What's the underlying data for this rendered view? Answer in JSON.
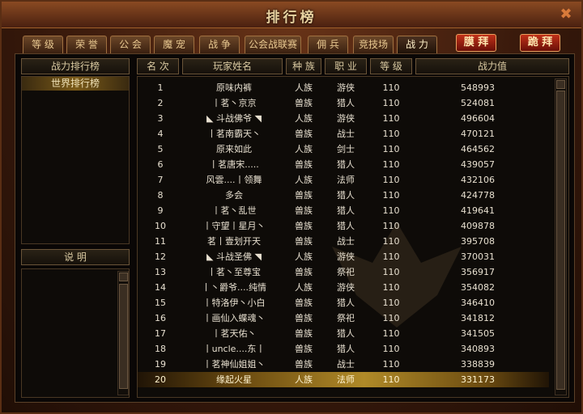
{
  "window": {
    "title": "排行榜",
    "close_icon": "✖"
  },
  "tabs": [
    {
      "label": "等 级",
      "active": false
    },
    {
      "label": "荣 誉",
      "active": false
    },
    {
      "label": "公 会",
      "active": false
    },
    {
      "label": "魔 宠",
      "active": false
    },
    {
      "label": "战 争",
      "active": false
    },
    {
      "label": "公会战联赛",
      "active": false
    },
    {
      "label": "佣 兵",
      "active": false
    },
    {
      "label": "竞技场",
      "active": false
    },
    {
      "label": "战 力",
      "active": true
    }
  ],
  "buttons": {
    "worship": "膜 拜",
    "kneel": "跪 拜"
  },
  "left_panel": {
    "header": "战力排行榜",
    "items": [
      {
        "label": "世界排行榜",
        "selected": true
      }
    ],
    "info_header": "说  明"
  },
  "table": {
    "columns": [
      "名 次",
      "玩家姓名",
      "种 族",
      "职 业",
      "等 级",
      "战力值"
    ],
    "rows": [
      {
        "rank": "1",
        "name": "原味内裤",
        "race": "人族",
        "class": "游侠",
        "level": "110",
        "power": "548993"
      },
      {
        "rank": "2",
        "name": "丨茗丶京京",
        "race": "兽族",
        "class": "猎人",
        "level": "110",
        "power": "524081"
      },
      {
        "rank": "3",
        "name": "◣ 斗战佛爷 ◥",
        "race": "人族",
        "class": "游侠",
        "level": "110",
        "power": "496604"
      },
      {
        "rank": "4",
        "name": "丨茗南霸天丶",
        "race": "兽族",
        "class": "战士",
        "level": "110",
        "power": "470121"
      },
      {
        "rank": "5",
        "name": "原来如此",
        "race": "人族",
        "class": "剑士",
        "level": "110",
        "power": "464562"
      },
      {
        "rank": "6",
        "name": "丨茗唐宋.....",
        "race": "兽族",
        "class": "猎人",
        "level": "110",
        "power": "439057"
      },
      {
        "rank": "7",
        "name": "风雲....丨领舞",
        "race": "人族",
        "class": "法师",
        "level": "110",
        "power": "432106"
      },
      {
        "rank": "8",
        "name": "多会",
        "race": "兽族",
        "class": "猎人",
        "level": "110",
        "power": "424778"
      },
      {
        "rank": "9",
        "name": "丨茗丶乱世",
        "race": "兽族",
        "class": "猎人",
        "level": "110",
        "power": "419641"
      },
      {
        "rank": "10",
        "name": "丨守望丨星月丶",
        "race": "兽族",
        "class": "猎人",
        "level": "110",
        "power": "409878"
      },
      {
        "rank": "11",
        "name": "茗丨壹划开天",
        "race": "兽族",
        "class": "战士",
        "level": "110",
        "power": "395708"
      },
      {
        "rank": "12",
        "name": "◣ 斗战圣佛 ◥",
        "race": "人族",
        "class": "游侠",
        "level": "110",
        "power": "370031"
      },
      {
        "rank": "13",
        "name": "丨茗丶至尊宝",
        "race": "兽族",
        "class": "祭祀",
        "level": "110",
        "power": "356917"
      },
      {
        "rank": "14",
        "name": "丨丶爵爷....纯情",
        "race": "人族",
        "class": "游侠",
        "level": "110",
        "power": "354082"
      },
      {
        "rank": "15",
        "name": "丨特洛伊丶小白",
        "race": "兽族",
        "class": "猎人",
        "level": "110",
        "power": "346410"
      },
      {
        "rank": "16",
        "name": "丨画仙入蝶魂丶",
        "race": "兽族",
        "class": "祭祀",
        "level": "110",
        "power": "341812"
      },
      {
        "rank": "17",
        "name": "丨茗天佑丶",
        "race": "兽族",
        "class": "猎人",
        "level": "110",
        "power": "341505"
      },
      {
        "rank": "18",
        "name": "丨uncle....东丨",
        "race": "兽族",
        "class": "猎人",
        "level": "110",
        "power": "340893"
      },
      {
        "rank": "19",
        "name": "丨茗神仙姐姐丶",
        "race": "兽族",
        "class": "战士",
        "level": "110",
        "power": "338839"
      },
      {
        "rank": "20",
        "name": "缘起火星",
        "race": "人族",
        "class": "法师",
        "level": "110",
        "power": "331173",
        "selected": true
      }
    ]
  },
  "colors": {
    "accent_gold": "#b08a28",
    "text": "#e8e0d0",
    "frame": "#5a2e14"
  }
}
